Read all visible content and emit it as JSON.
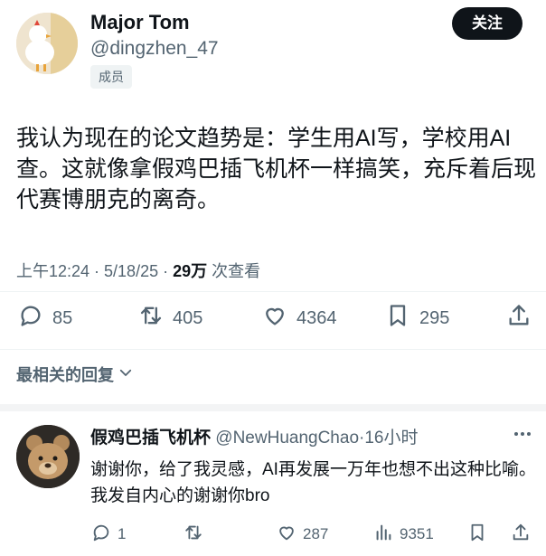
{
  "post": {
    "author_name": "Major Tom",
    "author_handle": "@dingzhen_47",
    "member_badge": "成员",
    "follow_label": "关注",
    "text": "我认为现在的论文趋势是：学生用AI写，学校用AI查。这就像拿假鸡巴插飞机杯一样搞笑，充斥着后现代赛博朋克的离奇。",
    "timestamp": "上午12:24 · 5/18/25 · ",
    "views_count": "29万",
    "views_label": " 次查看",
    "stats": {
      "replies": "85",
      "reposts": "405",
      "likes": "4364",
      "bookmarks": "295"
    }
  },
  "sort": {
    "label": "最相关的回复"
  },
  "reply": {
    "author_name": "假鸡巴插飞机杯",
    "author_handle": "@NewHuangChao",
    "time": "·16小时",
    "text": "谢谢你，给了我灵感，AI再发展一万年也想不出这种比喻。我发自内心的谢谢你bro",
    "stats": {
      "replies": "1",
      "likes": "287",
      "views": "9351"
    }
  },
  "colors": {
    "text_primary": "#0f1419",
    "text_secondary": "#536471",
    "divider": "#eff3f4",
    "follow_bg": "#0f1419"
  },
  "icons": [
    "reply-icon",
    "repost-icon",
    "like-icon",
    "bookmark-icon",
    "share-icon",
    "views-icon",
    "more-icon",
    "chevron-down-icon"
  ]
}
